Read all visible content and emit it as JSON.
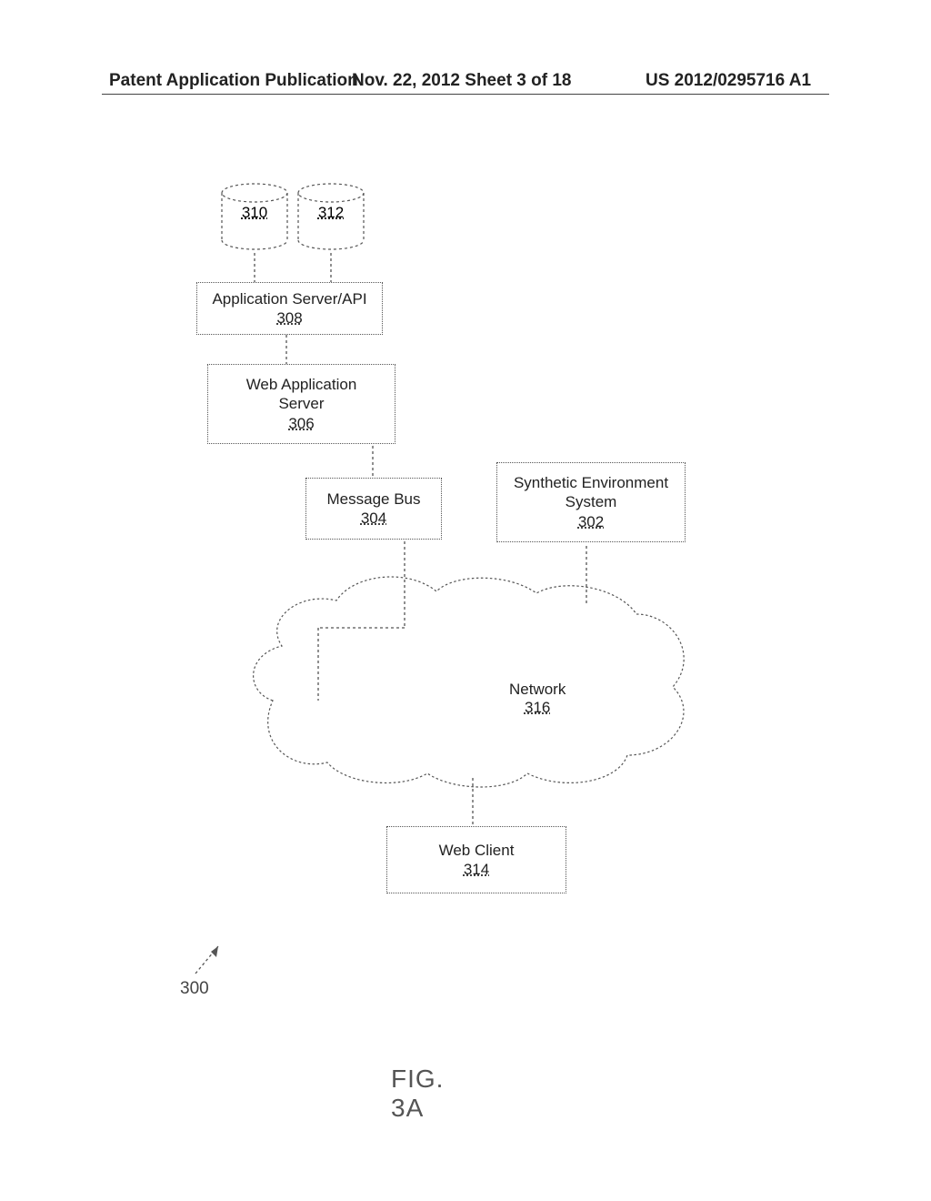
{
  "header": {
    "left": "Patent Application Publication",
    "center": "Nov. 22, 2012  Sheet 3 of 18",
    "right": "US 2012/0295716 A1"
  },
  "figure": {
    "ref_number": "300",
    "label": "FIG. 3A"
  },
  "blocks": {
    "db_left": {
      "ref": "310"
    },
    "db_right": {
      "ref": "312"
    },
    "app_server": {
      "label": "Application Server/API",
      "ref": "308"
    },
    "web_app_server": {
      "label_line1": "Web Application",
      "label_line2": "Server",
      "ref": "306"
    },
    "message_bus": {
      "label": "Message Bus",
      "ref": "304"
    },
    "synth_env": {
      "label_line1": "Synthetic Environment",
      "label_line2": "System",
      "ref": "302"
    },
    "network": {
      "label": "Network",
      "ref": "316"
    },
    "web_client": {
      "label": "Web Client",
      "ref": "314"
    }
  }
}
